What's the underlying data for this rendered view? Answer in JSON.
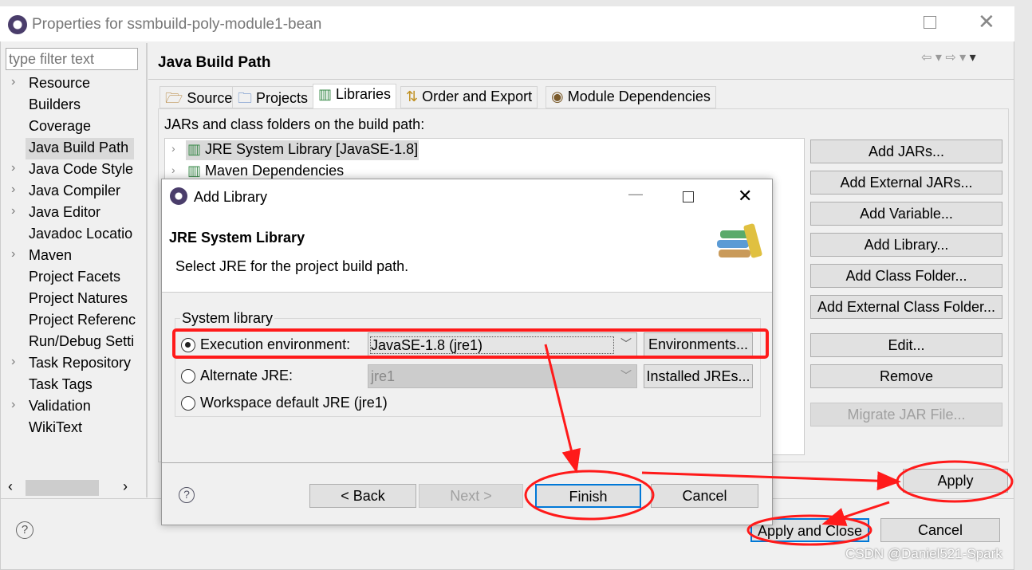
{
  "window": {
    "title": "Properties for ssmbuild-poly-module1-bean"
  },
  "filter": {
    "placeholder": "type filter text"
  },
  "sidebar": {
    "items": [
      {
        "label": "Resource",
        "expandable": true
      },
      {
        "label": "Builders",
        "expandable": false
      },
      {
        "label": "Coverage",
        "expandable": false
      },
      {
        "label": "Java Build Path",
        "expandable": false,
        "selected": true
      },
      {
        "label": "Java Code Style",
        "expandable": true
      },
      {
        "label": "Java Compiler",
        "expandable": true
      },
      {
        "label": "Java Editor",
        "expandable": true
      },
      {
        "label": "Javadoc Locatio",
        "expandable": false
      },
      {
        "label": "Maven",
        "expandable": true
      },
      {
        "label": "Project Facets",
        "expandable": false
      },
      {
        "label": "Project Natures",
        "expandable": false
      },
      {
        "label": "Project Referenc",
        "expandable": false
      },
      {
        "label": "Run/Debug Setti",
        "expandable": false
      },
      {
        "label": "Task Repository",
        "expandable": true
      },
      {
        "label": "Task Tags",
        "expandable": false
      },
      {
        "label": "Validation",
        "expandable": true
      },
      {
        "label": "WikiText",
        "expandable": false
      }
    ]
  },
  "page": {
    "title": "Java Build Path",
    "tabs": [
      {
        "label": "Source"
      },
      {
        "label": "Projects"
      },
      {
        "label": "Libraries",
        "active": true
      },
      {
        "label": "Order and Export"
      },
      {
        "label": "Module Dependencies"
      }
    ],
    "list_label": "JARs and class folders on the build path:",
    "entries": [
      "JRE System Library [JavaSE-1.8]",
      "Maven Dependencies"
    ],
    "buttons": [
      {
        "label": "Add JARs..."
      },
      {
        "label": "Add External JARs..."
      },
      {
        "label": "Add Variable..."
      },
      {
        "label": "Add Library..."
      },
      {
        "label": "Add Class Folder..."
      },
      {
        "label": "Add External Class Folder..."
      },
      {
        "label": "Edit..."
      },
      {
        "label": "Remove"
      },
      {
        "label": "Migrate JAR File...",
        "disabled": true
      }
    ],
    "apply": "Apply",
    "apply_close": "Apply and Close",
    "cancel": "Cancel"
  },
  "dialog": {
    "title": "Add Library",
    "header": "JRE System Library",
    "description": "Select JRE for the project build path.",
    "group_label": "System library",
    "options": [
      {
        "label": "Execution environment:",
        "value": "JavaSE-1.8 (jre1)",
        "button": "Environments...",
        "selected": true
      },
      {
        "label": "Alternate JRE:",
        "value": "jre1",
        "button": "Installed JREs...",
        "selected": false
      },
      {
        "label": "Workspace default JRE (jre1)",
        "selected": false
      }
    ],
    "back": "< Back",
    "next": "Next >",
    "finish": "Finish",
    "cancel": "Cancel"
  },
  "watermark": "CSDN @Daniel521-Spark",
  "colors": {
    "annotation": "#ff1a1a",
    "focus": "#0078d7"
  }
}
